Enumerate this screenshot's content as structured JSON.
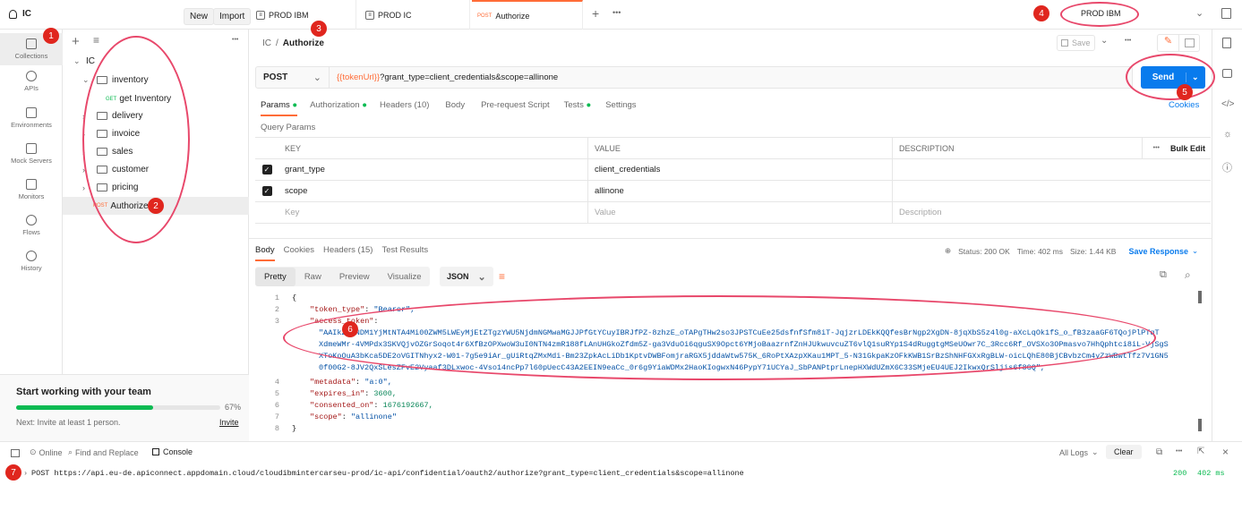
{
  "workspace": {
    "name": "IC",
    "new_label": "New",
    "import_label": "Import"
  },
  "tabs": [
    {
      "label": "PROD IBM"
    },
    {
      "label": "PROD IC"
    },
    {
      "method": "POST",
      "label": "Authorize"
    }
  ],
  "environment": {
    "selected": "PROD IBM"
  },
  "sidebar_nav": [
    {
      "label": "Collections"
    },
    {
      "label": "APIs"
    },
    {
      "label": "Environments"
    },
    {
      "label": "Mock Servers"
    },
    {
      "label": "Monitors"
    },
    {
      "label": "Flows"
    },
    {
      "label": "History"
    }
  ],
  "tree": {
    "root": "IC",
    "items": [
      {
        "label": "inventory"
      },
      {
        "method": "GET",
        "label": "get Inventory"
      },
      {
        "label": "delivery"
      },
      {
        "label": "invoice"
      },
      {
        "label": "sales"
      },
      {
        "label": "customer"
      },
      {
        "label": "pricing"
      },
      {
        "method": "POST",
        "label": "Authorize"
      }
    ]
  },
  "onboarding": {
    "title": "Start working with your team",
    "progress_label": "67%",
    "progress_value": 0.67,
    "next_label": "Next: Invite at least 1 person.",
    "invite_label": "Invite"
  },
  "breadcrumb": {
    "parent": "IC",
    "sep": "/",
    "current": "Authorize"
  },
  "save_label": "Save",
  "request": {
    "method": "POST",
    "url_var": "{{tokenUrl}}",
    "url_rest": "?grant_type=client_credentials&scope=allinone",
    "send_label": "Send"
  },
  "req_tabs": {
    "params": "Params",
    "authorization": "Authorization",
    "headers": "Headers (10)",
    "body": "Body",
    "prerequest": "Pre-request Script",
    "tests": "Tests",
    "settings": "Settings",
    "cookies": "Cookies"
  },
  "query_params": {
    "title": "Query Params",
    "headers": {
      "key": "KEY",
      "value": "VALUE",
      "description": "DESCRIPTION",
      "bulk": "Bulk Edit"
    },
    "rows": [
      {
        "key": "grant_type",
        "value": "client_credentials"
      },
      {
        "key": "scope",
        "value": "allinone"
      }
    ],
    "placeholders": {
      "key": "Key",
      "value": "Value",
      "description": "Description"
    }
  },
  "response": {
    "tabs": {
      "body": "Body",
      "cookies": "Cookies",
      "headers": "Headers (15)",
      "tests": "Test Results"
    },
    "status": "Status: 200 OK",
    "time": "Time: 402 ms",
    "size": "Size: 1.44 KB",
    "save_response": "Save Response",
    "view_tabs": {
      "pretty": "Pretty",
      "raw": "Raw",
      "preview": "Preview",
      "visualize": "Visualize",
      "format": "JSON"
    },
    "lines": [
      {
        "n": "1",
        "text": "{"
      },
      {
        "n": "2",
        "key": "\"token_type\"",
        "val": "\"Bearer\","
      },
      {
        "n": "3",
        "key": "\"access_token\"",
        "val": ""
      },
      {
        "n": "",
        "val": "\"AAIkZTzNDM1YjMtNTA4Mi00ZWM5LWEyMjEtZTgzYWU5NjdmNGMwaMGJJPfGtYCuyIBRJfPZ-8zhzE_oTAPgTHw2so3JPSTCuEe25dsfnfSfm8iT-JqjzrLDEkKQQfesBrNgp2XgDN-8jqXbS5z4l0g-aXcLqOk1fS_o_fB3zaaGF6TQojPlPTqT"
      },
      {
        "n": "",
        "val": "XdmeWMr-4VMPdx3SKVQjvOZGrSoqot4r6XfBzOPXwoW3uI0NTN4zmR188fLAnUHGkoZfdm5Z-ga3VduOi6qguSX9Opct6YMjoBaazrnfZnHJUkwuvcuZT6vlQ1suRYp1S4dRuggtgMSeUOwr7C_3Rcc6Rf_OVSXo3OPmasvo7HhQphtci8iL-VjSgS"
      },
      {
        "n": "",
        "val": "XToKoOuA3bKca5DE2oVGITNhyx2-W01-7g5e9iAr_gUiRtqZMxMdi-Bm23ZpkAcLiDb1KptvDWBFomjraRGX5jddaWtw575K_6RoPtXAzpXKau1MPT_5-N31GkpaKzOFkKWB1SrBzShNHFGXxRgBLW-oicLQhE80BjCBvbzCm4yZzWBwtTfz7V1GN5"
      },
      {
        "n": "",
        "val": "0f00G2-8JV2QxSLesZFvE2Vyaaf3DLxwoc-4Vso14ncPp7l60pUecC43A2EEIN9eaCc_0r6g9YiaWDMx2HaoKIogwxN46PypY71UCYaJ_SbPANPtprLnepHXWdUZmX6C33SMjeEU4UEJ2IkwxQrSljis6f8GQ\","
      },
      {
        "n": "4",
        "key": "\"metadata\"",
        "val": "\"a:0\","
      },
      {
        "n": "5",
        "key": "\"expires_in\"",
        "val": "3600,"
      },
      {
        "n": "6",
        "key": "\"consented_on\"",
        "val": "1676192667,"
      },
      {
        "n": "7",
        "key": "\"scope\"",
        "val": "\"allinone\""
      },
      {
        "n": "8",
        "text": "}"
      }
    ]
  },
  "footer": {
    "online": "Online",
    "find_replace": "Find and Replace",
    "console": "Console",
    "all_logs": "All Logs",
    "clear": "Clear"
  },
  "console": {
    "method": "POST",
    "url": "https://api.eu-de.apiconnect.appdomain.cloud/cloudibmintercarseu-prod/ic-api/confidential/oauth2/authorize?grant_type=client_credentials&scope=allinone",
    "status": "200",
    "time": "402 ms"
  },
  "annotations": [
    "1",
    "2",
    "3",
    "4",
    "5",
    "6",
    "7"
  ],
  "colors": {
    "accent": "#ff6c37",
    "send": "#097bed",
    "annotation": "#e0261e",
    "ring": "#e8486b",
    "progress": "#0cbb52"
  }
}
